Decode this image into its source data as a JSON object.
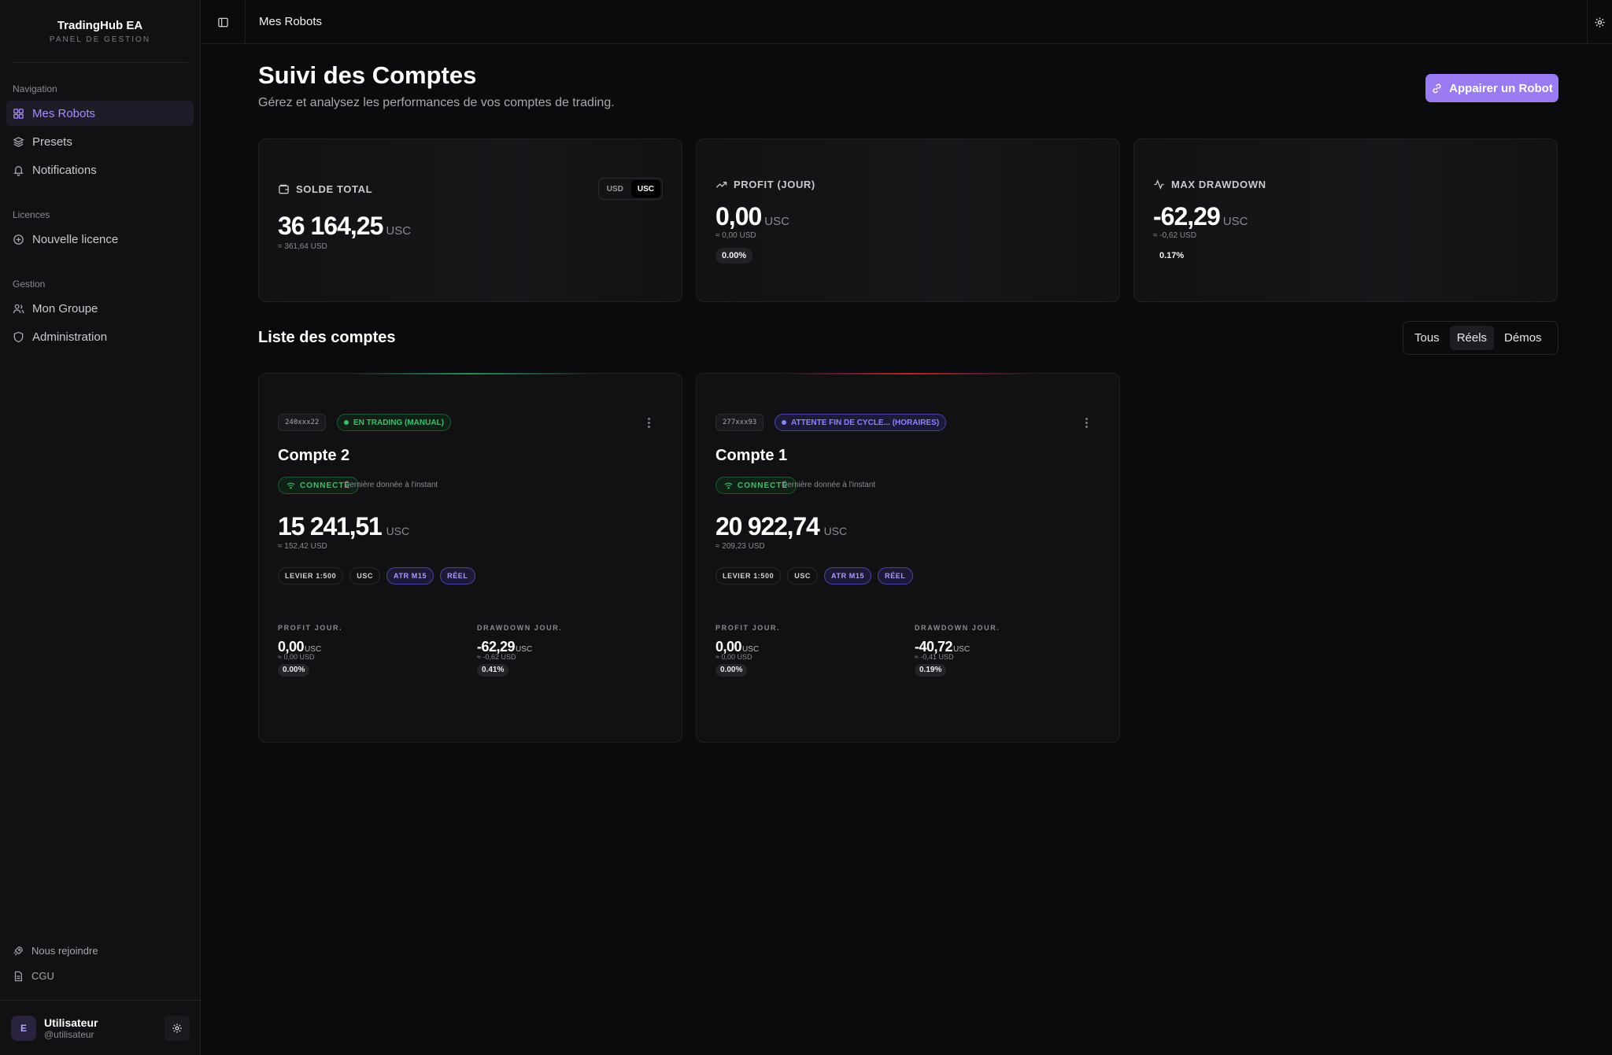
{
  "brand": {
    "title": "TradingHub EA",
    "subtitle": "PANEL DE GESTION"
  },
  "sidebar": {
    "sections": [
      {
        "label": "Navigation"
      },
      {
        "label": "Licences"
      },
      {
        "label": "Gestion"
      }
    ],
    "items": [
      {
        "label": "Mes Robots",
        "icon": "grid-icon",
        "active": true
      },
      {
        "label": "Presets",
        "icon": "layers-icon"
      },
      {
        "label": "Notifications",
        "icon": "bell-icon"
      },
      {
        "label": "Nouvelle licence",
        "icon": "plus-circle-icon"
      },
      {
        "label": "Mon Groupe",
        "icon": "users-icon"
      },
      {
        "label": "Administration",
        "icon": "shield-icon"
      }
    ],
    "footer": [
      {
        "label": "Nous rejoindre",
        "icon": "rocket-icon"
      },
      {
        "label": "CGU",
        "icon": "file-icon"
      }
    ],
    "user": {
      "initial": "E",
      "name": "Utilisateur",
      "handle": "@utilisateur"
    }
  },
  "header": {
    "breadcrumb": "Mes Robots"
  },
  "page": {
    "title": "Suivi des Comptes",
    "subtitle": "Gérez et analysez les performances de vos comptes de trading.",
    "primary_action": "Appairer un Robot"
  },
  "stats": {
    "balance": {
      "label": "SOLDE TOTAL",
      "value": "36 164,25",
      "unit": "USC",
      "approx": "≈ 361,64 USD",
      "currency_options": [
        "USD",
        "USC"
      ],
      "currency_selected": "USC"
    },
    "profit": {
      "label": "PROFIT (JOUR)",
      "value": "0,00",
      "unit": "USC",
      "approx": "≈ 0,00 USD",
      "pct": "0.00%"
    },
    "drawdown": {
      "label": "MAX DRAWDOWN",
      "value": "-62,29",
      "unit": "USC",
      "approx": "≈ -0,62 USD",
      "pct": "0.17%"
    }
  },
  "accounts_section": {
    "title": "Liste des comptes",
    "filters": [
      "Tous",
      "Réels",
      "Démos"
    ],
    "filter_selected": "Réels"
  },
  "accounts": [
    {
      "id": "240xxx22",
      "status": "EN TRADING (MANUAL)",
      "status_color": "#3fbf6b",
      "accent": "#2e8b4e",
      "name": "Compte 2",
      "connection": "CONNECTÉ",
      "last_data": "Dernière donnée à l'instant",
      "balance": "15 241,51",
      "unit": "USC",
      "approx": "≈ 152,42 USD",
      "tags": [
        "LEVIER 1:500",
        "USC",
        "ATR M15",
        "RÉEL"
      ],
      "profit_label": "PROFIT JOUR.",
      "profit": "0,00",
      "profit_unit": "USC",
      "profit_approx": "≈ 0,00 USD",
      "profit_pct": "0.00%",
      "dd_label": "DRAWDOWN JOUR.",
      "dd": "-62,29",
      "dd_unit": "USC",
      "dd_approx": "≈ -0,62 USD",
      "dd_pct": "0.41%"
    },
    {
      "id": "277xxx93",
      "status": "ATTENTE FIN DE CYCLE... (HORAIRES)",
      "status_color": "#8b83ff",
      "accent": "#b3262b",
      "name": "Compte 1",
      "connection": "CONNECTÉ",
      "last_data": "Dernière donnée à l'instant",
      "balance": "20 922,74",
      "unit": "USC",
      "approx": "≈ 209,23 USD",
      "tags": [
        "LEVIER 1:500",
        "USC",
        "ATR M15",
        "RÉEL"
      ],
      "profit_label": "PROFIT JOUR.",
      "profit": "0,00",
      "profit_unit": "USC",
      "profit_approx": "≈ 0,00 USD",
      "profit_pct": "0.00%",
      "dd_label": "DRAWDOWN JOUR.",
      "dd": "-40,72",
      "dd_unit": "USC",
      "dd_approx": "≈ -0,41 USD",
      "dd_pct": "0.19%"
    }
  ]
}
